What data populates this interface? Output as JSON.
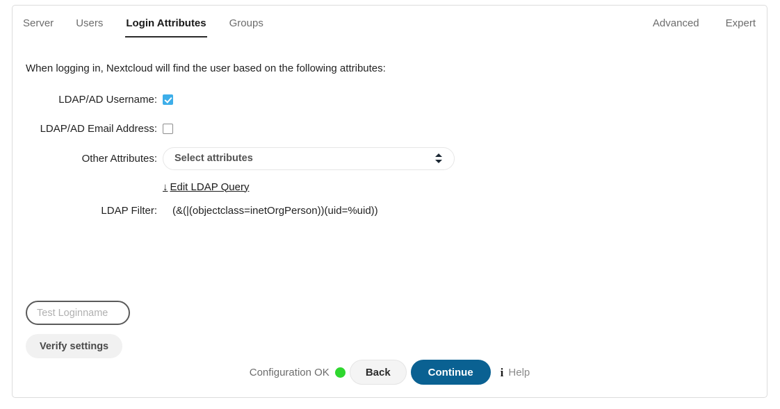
{
  "tabs": {
    "left": [
      {
        "label": "Server",
        "active": false
      },
      {
        "label": "Users",
        "active": false
      },
      {
        "label": "Login Attributes",
        "active": true
      },
      {
        "label": "Groups",
        "active": false
      }
    ],
    "right": [
      {
        "label": "Advanced"
      },
      {
        "label": "Expert"
      }
    ]
  },
  "main": {
    "intro": "When logging in, Nextcloud will find the user based on the following attributes:",
    "fields": {
      "username_label": "LDAP/AD Username:",
      "username_checked": true,
      "email_label": "LDAP/AD Email Address:",
      "email_checked": false,
      "other_attributes_label": "Other Attributes:",
      "other_attributes_value": "Select attributes",
      "edit_query_arrow": "↓",
      "edit_query_label": "Edit LDAP Query",
      "ldap_filter_label": "LDAP Filter:",
      "ldap_filter_value": "(&(|(objectclass=inetOrgPerson))(uid=%uid))"
    },
    "test": {
      "login_placeholder": "Test Loginname",
      "login_value": "",
      "verify_label": "Verify settings"
    },
    "actions": {
      "status_label": "Configuration OK",
      "status_color": "#2fd72f",
      "back_label": "Back",
      "continue_label": "Continue",
      "help_label": "Help"
    }
  }
}
